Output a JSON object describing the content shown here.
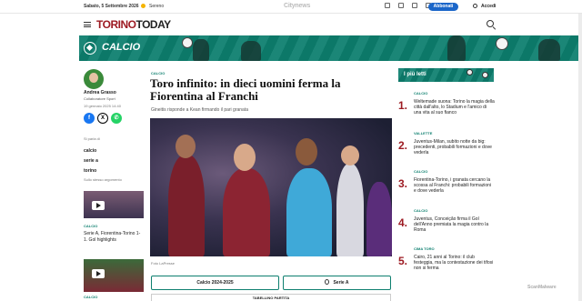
{
  "topbar": {
    "date": "Sabato, 5 Settembre 2026",
    "weather": "Sereno",
    "brand": "Citynews",
    "subscribe_label": "Abbonati",
    "login_label": "Accedi"
  },
  "header": {
    "logo_part1": "TORINO",
    "logo_part2": "TODAY"
  },
  "banner": {
    "label": "CALCIO",
    "color": "#0d7f6f"
  },
  "author": {
    "name": "Andrea Grasso",
    "role": "Collaboratore Sport",
    "date": "19 gennaio 2025 14:40"
  },
  "share": {
    "fb": "f",
    "x": "X",
    "wa": "✆"
  },
  "topics": {
    "heading": "Si parla di",
    "tags": [
      "calcio",
      "serie a",
      "torino"
    ]
  },
  "related": {
    "heading": "Sullo stesso argomento",
    "items": [
      {
        "category": "CALCIO",
        "title": "Serie A, Fiorentina-Torino 1-1. Gol highlights"
      },
      {
        "category": "CALCIO",
        "title": ""
      }
    ]
  },
  "article": {
    "category": "CALCIO",
    "title": "Toro infinito: in dieci uomini ferma la Fiorentina al Franchi",
    "subtitle": "Gineitis risponde a Kean firmando il pari granata",
    "photo_caption": "Foto LaPresse",
    "pill_a": "Calcio 2024-2025",
    "pill_b": "Serie A",
    "tabellino": "TABELLINO PARTITA"
  },
  "most_read": {
    "heading": "I più letti",
    "items": [
      {
        "num": "1.",
        "category": "CALCIO",
        "title": "Weltemade suona: Torino la magia della città dall'alto, lo Stadium e l'amico di una vita al suo fianco"
      },
      {
        "num": "2.",
        "category": "VALLETTE",
        "title": "Juventus-Milan, subito notte da big: precedenti, probabili formazioni e dove vederla"
      },
      {
        "num": "3.",
        "category": "CALCIO",
        "title": "Fiorentina-Torino, i granata cercano la scossa al Franchi: probabili formazioni e dove vederla"
      },
      {
        "num": "4.",
        "category": "CALCIO",
        "title": "Juventus, Conceição firma il Gol dell'Anno premiata la magia contro la Roma"
      },
      {
        "num": "5.",
        "category": "CIMA TORO",
        "title": "Cairo, 21 anni al Torino: il club festeggia, ma la contestazione dei tifosi non si ferma"
      }
    ]
  },
  "watermark": "ScanMalware"
}
